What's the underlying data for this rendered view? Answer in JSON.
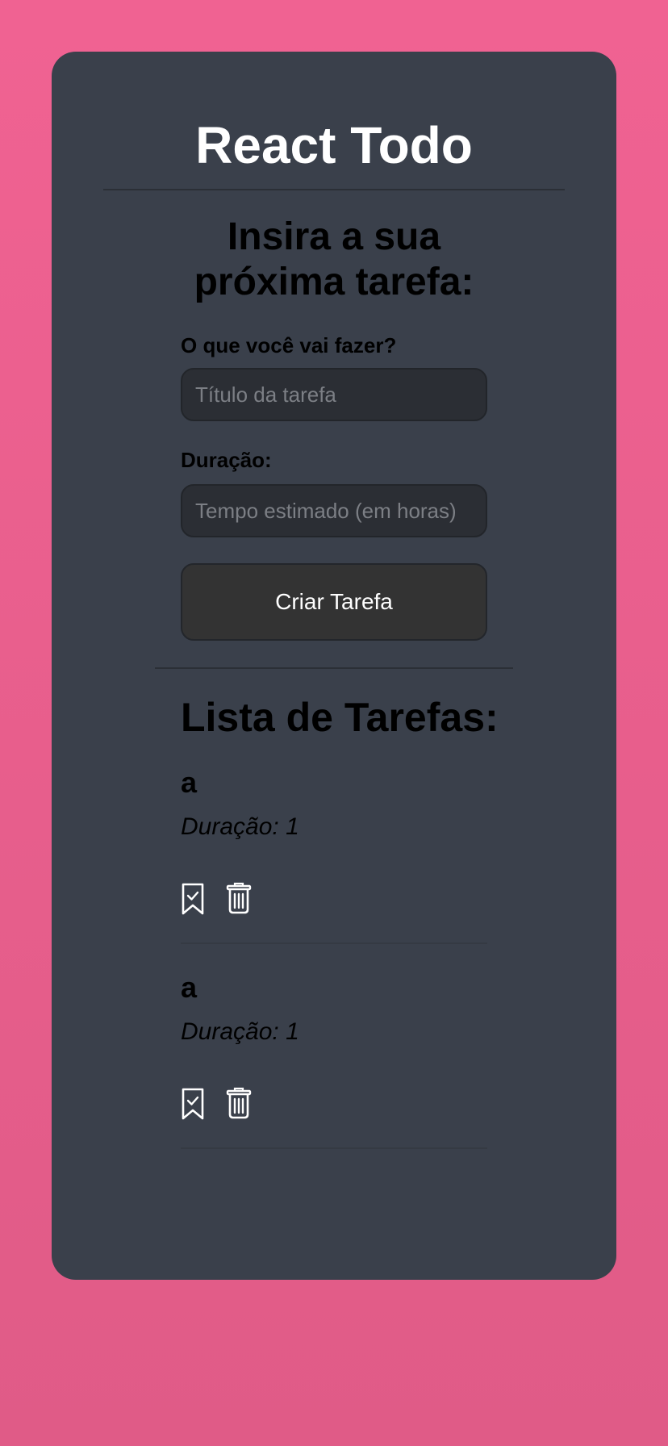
{
  "app": {
    "title": "React Todo"
  },
  "form": {
    "heading": "Insira a sua próxima tarefa:",
    "title_label": "O que você vai fazer?",
    "title_placeholder": "Título da tarefa",
    "duration_label": "Duração:",
    "duration_placeholder": "Tempo estimado (em horas)",
    "submit_label": "Criar Tarefa"
  },
  "list": {
    "heading": "Lista de Tarefas:",
    "tasks": [
      {
        "title": "a",
        "duration_text": "Duração: 1"
      },
      {
        "title": "a",
        "duration_text": "Duração: 1"
      }
    ]
  },
  "icons": {
    "complete": "bookmark-check-icon",
    "delete": "trash-icon"
  },
  "colors": {
    "background": "#f06292",
    "card": "#3a404b",
    "input_bg": "#2b2e34",
    "button_bg": "#333333",
    "text": "#ffffff"
  }
}
